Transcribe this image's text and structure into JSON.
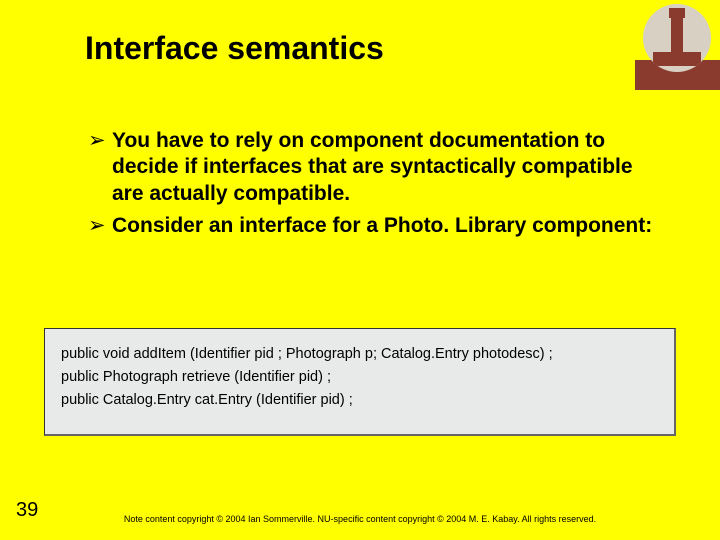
{
  "title": "Interface semantics",
  "bullets": [
    "You have to rely on component documentation to decide if interfaces that are syntactically compatible are actually compatible.",
    "Consider an interface for a Photo. Library component:"
  ],
  "code": {
    "line1": "public void addItem (Identifier pid ; Photograph p; Catalog.Entry photodesc) ;",
    "line2": "public Photograph retrieve (Identifier pid) ;",
    "line3": "public Catalog.Entry cat.Entry (Identifier pid) ;"
  },
  "page_number": "39",
  "footer": "Note content copyright © 2004 Ian Sommerville.  NU-specific content copyright © 2004 M. E. Kabay.  All rights reserved."
}
